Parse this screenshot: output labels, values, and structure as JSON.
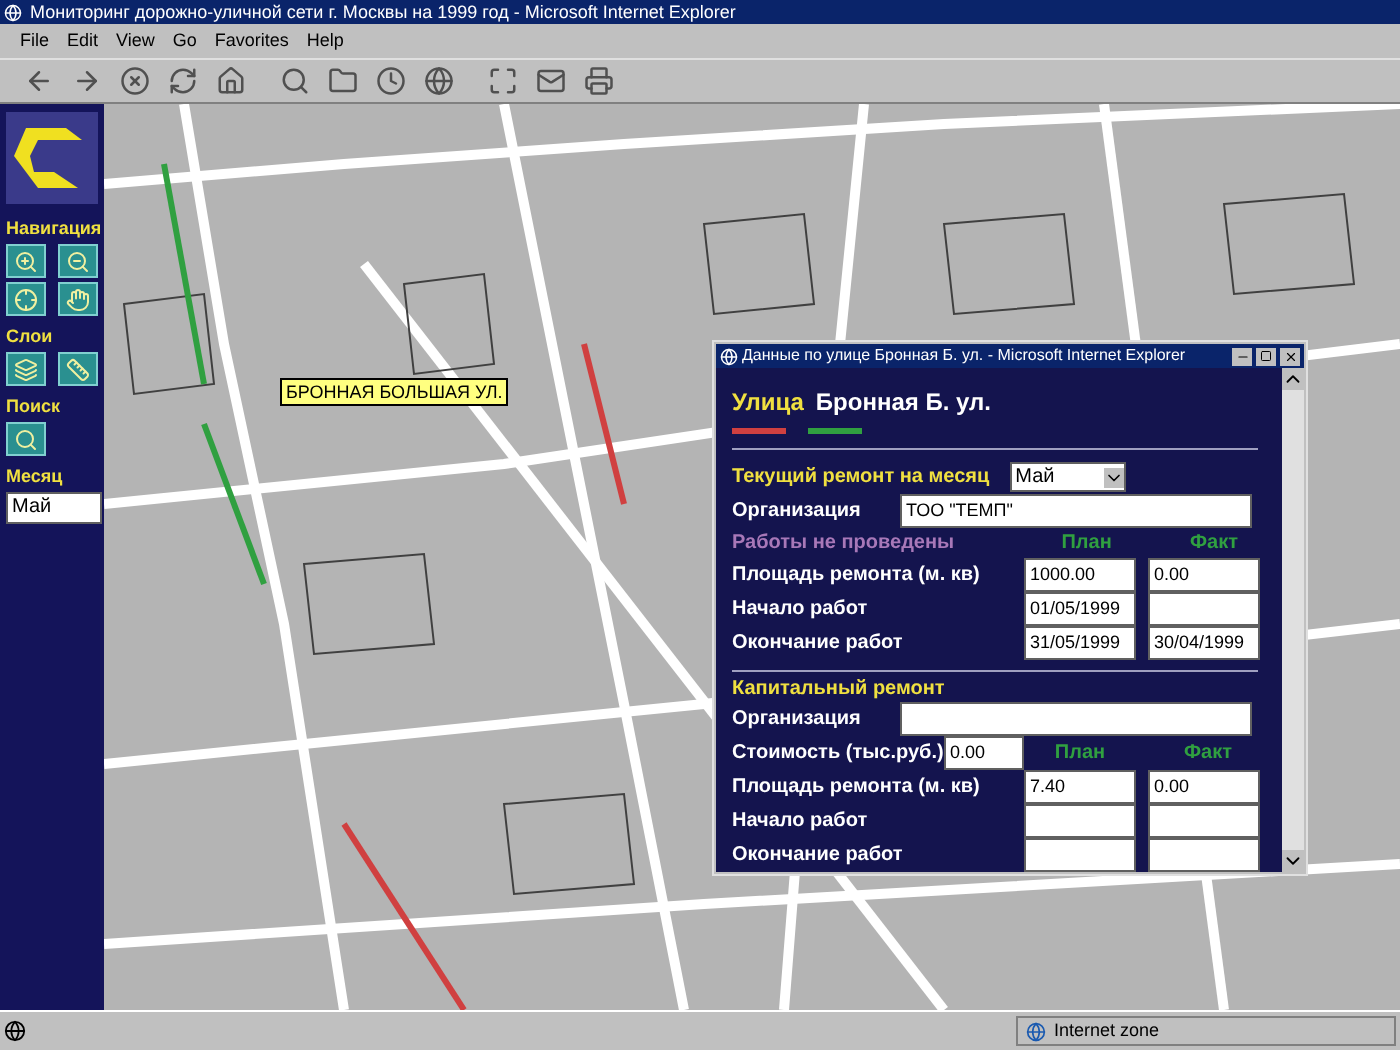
{
  "window": {
    "title": "Мониторинг дорожно-уличной сети г. Москвы на 1999 год - Microsoft Internet Explorer"
  },
  "menu": [
    "File",
    "Edit",
    "View",
    "Go",
    "Favorites",
    "Help"
  ],
  "sidebar": {
    "sections": [
      {
        "kind": "nav",
        "title": "Навигация"
      },
      {
        "kind": "layers",
        "title": "Слои"
      },
      {
        "kind": "search",
        "title": "Поиск"
      },
      {
        "kind": "month",
        "title": "Месяц",
        "value": "Май"
      }
    ]
  },
  "map": {
    "tooltip": "БРОННАЯ БОЛЬШАЯ УЛ."
  },
  "popup": {
    "title": "Данные по улице Бронная Б. ул. - Microsoft Internet Explorer",
    "street_label": "Улица",
    "street_name": "Бронная Б. ул.",
    "legend": [
      {
        "color": "#d04040"
      },
      {
        "color": "#30a040"
      }
    ],
    "current": {
      "title": "Текущий ремонт на месяц",
      "month": "Май",
      "org_label": "Организация",
      "org_value": "ТОО \"ТЕМП\"",
      "status": "Работы не проведены",
      "plan_header": "План",
      "fact_header": "Факт",
      "rows": [
        {
          "label": "Площадь ремонта (м. кв)",
          "plan": "1000.00",
          "fact": "0.00"
        },
        {
          "label": "Начало работ",
          "plan": "01/05/1999"
        },
        {
          "label": "Окончание работ",
          "plan": "31/05/1999",
          "fact": "30/04/1999"
        }
      ]
    },
    "capital": {
      "title": "Капитальный ремонт",
      "org_label": "Организация",
      "cost_label": "Стоимость (тыс.руб.)",
      "cost_value": "0.00",
      "plan_header": "План",
      "fact_header": "Факт",
      "rows": [
        {
          "label": "Площадь ремонта (м. кв)",
          "plan": "7.40",
          "fact": "0.00"
        },
        {
          "label": "Начало работ"
        },
        {
          "label": "Окончание работ"
        }
      ]
    }
  },
  "status_bar": {
    "zone": "Internet zone"
  }
}
